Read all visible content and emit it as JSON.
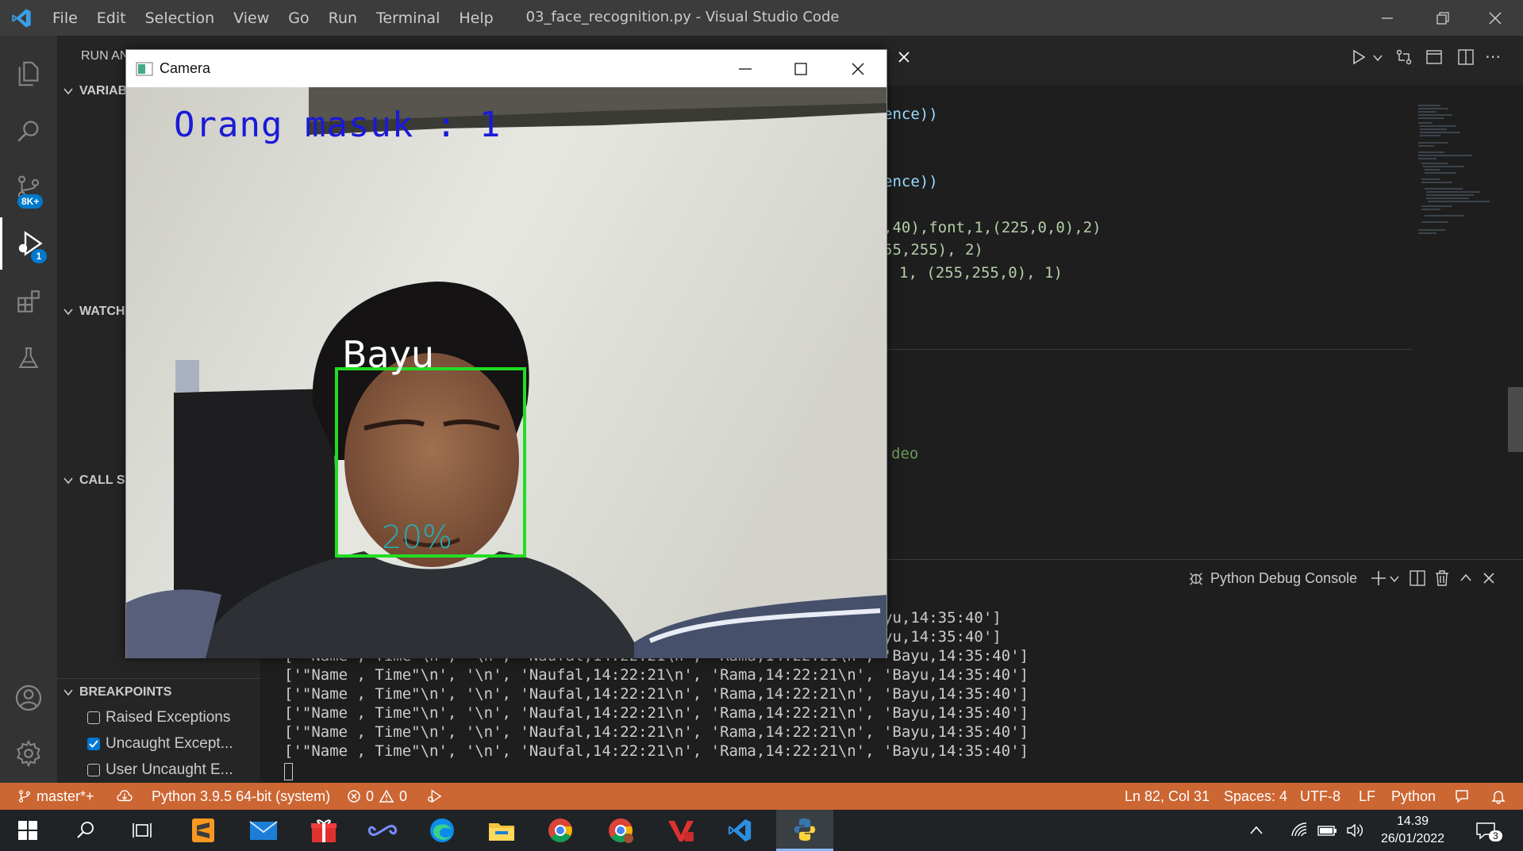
{
  "window_title": "03_face_recognition.py - Visual Studio Code",
  "menu": [
    "File",
    "Edit",
    "Selection",
    "View",
    "Go",
    "Run",
    "Terminal",
    "Help"
  ],
  "activity": {
    "source_control_badge": "8K+",
    "debug_badge": "1"
  },
  "sidebar": {
    "header": "RUN AN",
    "sections": {
      "variables": "VARIAB",
      "watch": "WATCH",
      "call_stack": "CALL ST",
      "breakpoints": "BREAKPOINTS"
    },
    "breakpoints": [
      {
        "label": "Raised Exceptions",
        "checked": false
      },
      {
        "label": "Uncaught Except...",
        "checked": true
      },
      {
        "label": "User Uncaught E...",
        "checked": false
      }
    ]
  },
  "editor": {
    "lines": [
      {
        "text": "ence))",
        "color": "#9cdcfe"
      },
      {
        "text": "ence))",
        "color": "#9cdcfe"
      },
      {
        "text": ",40),font,1,(225,0,0),2)",
        "color": "#9cdcfe"
      },
      {
        "text": "55,255), 2)",
        "color": "#b5cea8"
      },
      {
        "text": "1, (255,255,0), 1)",
        "color": "#b5cea8"
      },
      {
        "text": "deo",
        "color": "#6a9955"
      }
    ]
  },
  "panel": {
    "title": "Python Debug Console",
    "partial_lines": [
      "yu,14:35:40']",
      "yu,14:35:40']"
    ],
    "overlapped_line": "['\"Name , Time\"\\n', '\\n', 'Naufal,14:22:21\\n', 'Rama,14:22:21\\n', 'Bayu,14:35:40']",
    "lines": [
      "['\"Name , Time\"\\n', '\\n', 'Naufal,14:22:21\\n', 'Rama,14:22:21\\n', 'Bayu,14:35:40']",
      "['\"Name , Time\"\\n', '\\n', 'Naufal,14:22:21\\n', 'Rama,14:22:21\\n', 'Bayu,14:35:40']",
      "['\"Name , Time\"\\n', '\\n', 'Naufal,14:22:21\\n', 'Rama,14:22:21\\n', 'Bayu,14:35:40']",
      "['\"Name , Time\"\\n', '\\n', 'Naufal,14:22:21\\n', 'Rama,14:22:21\\n', 'Bayu,14:35:40']",
      "['\"Name , Time\"\\n', '\\n', 'Naufal,14:22:21\\n', 'Rama,14:22:21\\n', 'Bayu,14:35:40']",
      "['\"Name , Time\"\\n', '\\n', 'Naufal,14:22:21\\n', 'Rama,14:22:21\\n', 'Bayu,14:35:40']"
    ]
  },
  "status": {
    "branch": "master*+",
    "interpreter": "Python 3.9.5 64-bit (system)",
    "errors": "0",
    "warnings": "0",
    "position": "Ln 82, Col 31",
    "spaces": "Spaces: 4",
    "encoding": "UTF-8",
    "eol": "LF",
    "language": "Python"
  },
  "camera": {
    "title": "Camera",
    "counter_text": "Orang masuk : 1",
    "name_label": "Bayu",
    "confidence": "20%"
  },
  "taskbar": {
    "time": "14.39",
    "date": "26/01/2022",
    "notifications": "3"
  },
  "colors": {
    "statusbar": "#cc6633",
    "accent": "#007acc",
    "box": "#22dd22",
    "counter": "#1a1ad8"
  }
}
